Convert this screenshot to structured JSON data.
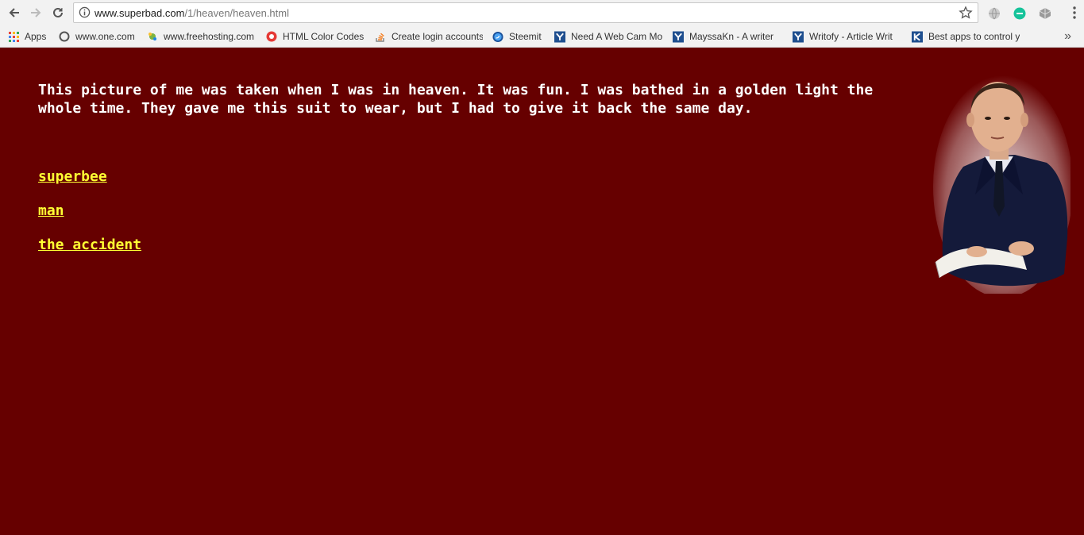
{
  "browser": {
    "url_host": "www.superbad.com",
    "url_path": "/1/heaven/heaven.html",
    "bookmarks": [
      {
        "label": "Apps",
        "icon": "apps-grid-icon"
      },
      {
        "label": "www.one.com",
        "icon": "one-com-icon"
      },
      {
        "label": "www.freehosting.com",
        "icon": "freehosting-icon"
      },
      {
        "label": "HTML Color Codes",
        "icon": "html-color-codes-icon"
      },
      {
        "label": "Create login accounts",
        "icon": "stack-overflow-icon"
      },
      {
        "label": "Steemit",
        "icon": "steemit-icon"
      },
      {
        "label": "Need A Web Cam Mo",
        "icon": "y-bookmark-icon"
      },
      {
        "label": "MayssaKn - A writer",
        "icon": "y-bookmark-icon"
      },
      {
        "label": "Writofy - Article Writ",
        "icon": "y-bookmark-icon"
      },
      {
        "label": "Best apps to control y",
        "icon": "k-bookmark-icon"
      }
    ],
    "more_bookmarks": "»"
  },
  "page": {
    "paragraph": "This picture of me was taken when I was in heaven. It was fun. I was bathed in a golden light the whole time. They gave me this suit to wear, but I had to give it back the same day.",
    "links": [
      "superbee",
      "man",
      "the accident"
    ]
  },
  "colors": {
    "background": "#660000",
    "text": "#ffffff",
    "link": "#ffff33"
  }
}
